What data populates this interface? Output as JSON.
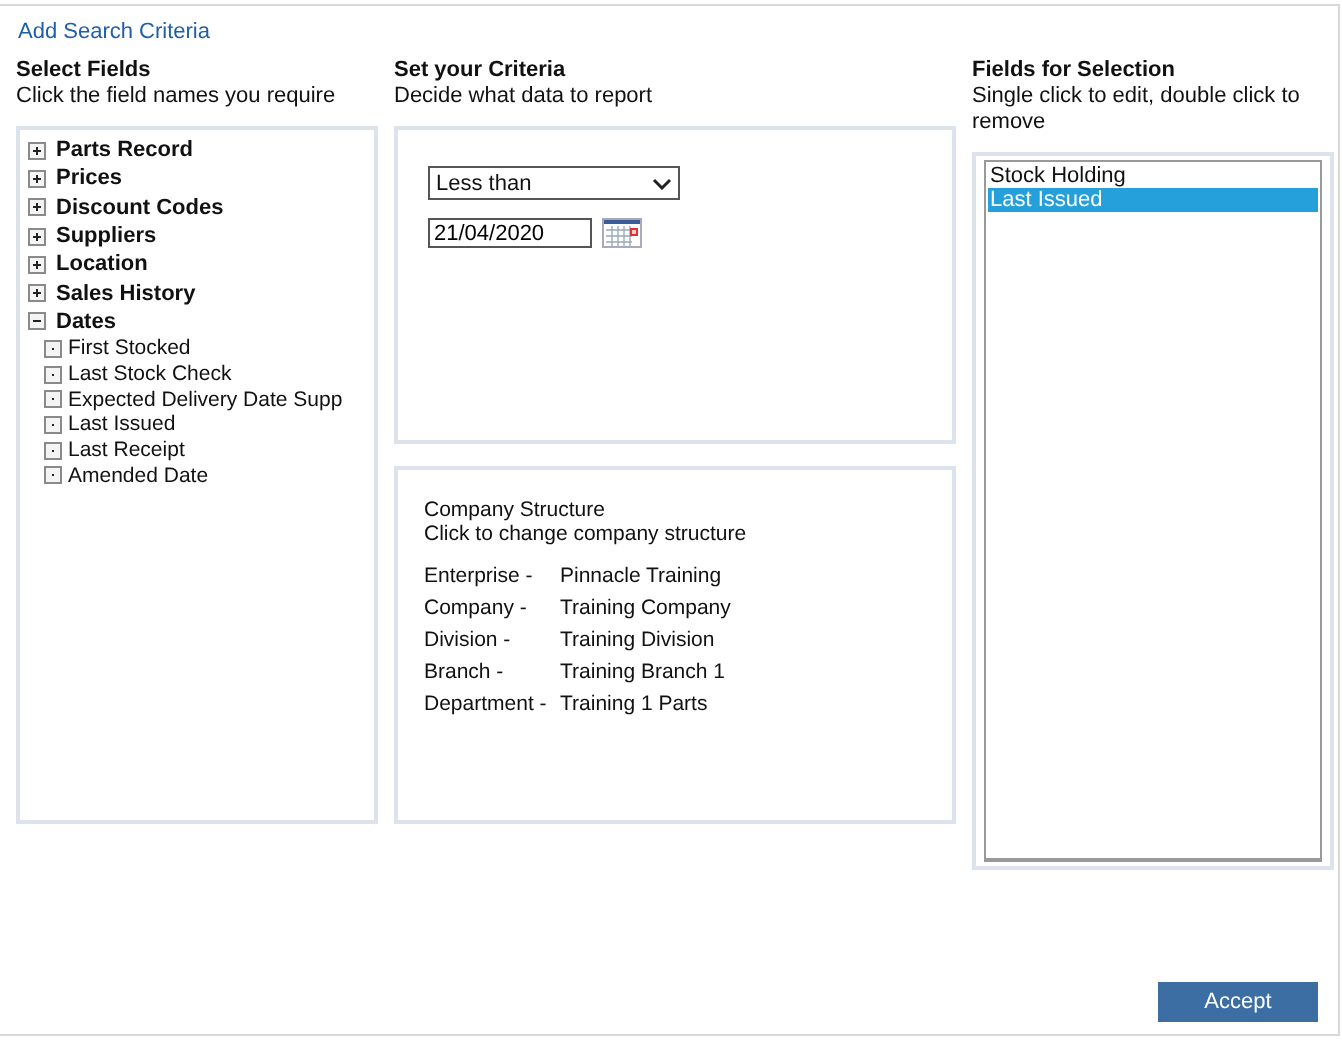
{
  "title": "Add Search Criteria",
  "select_fields": {
    "heading": "Select Fields",
    "hint": "Click the field names you require",
    "tree": [
      {
        "label": "Parts Record",
        "expanded": false
      },
      {
        "label": "Prices",
        "expanded": false
      },
      {
        "label": "Discount Codes",
        "expanded": false
      },
      {
        "label": "Suppliers",
        "expanded": false
      },
      {
        "label": "Location",
        "expanded": false
      },
      {
        "label": "Sales History",
        "expanded": false
      },
      {
        "label": "Dates",
        "expanded": true,
        "children": [
          {
            "label": "First Stocked"
          },
          {
            "label": "Last Stock Check"
          },
          {
            "label": "Expected Delivery Date Supp"
          },
          {
            "label": "Last Issued"
          },
          {
            "label": "Last Receipt"
          },
          {
            "label": "Amended Date"
          }
        ]
      }
    ]
  },
  "criteria": {
    "heading": "Set your Criteria",
    "hint": "Decide what data to report",
    "operator": "Less than",
    "date": "21/04/2020"
  },
  "company_structure": {
    "title": "Company Structure",
    "hint": "Click to change company structure",
    "rows": [
      {
        "label": "Enterprise -",
        "value": "Pinnacle Training"
      },
      {
        "label": "Company -",
        "value": "Training Company"
      },
      {
        "label": "Division -",
        "value": "Training Division"
      },
      {
        "label": "Branch -",
        "value": "Training Branch 1"
      },
      {
        "label": "Department -",
        "value": "Training 1 Parts"
      }
    ]
  },
  "fields_for_selection": {
    "heading": "Fields for Selection",
    "hint": "Single click to edit, double click to remove",
    "items": [
      {
        "label": "Stock Holding",
        "selected": false
      },
      {
        "label": "Last Issued",
        "selected": true
      }
    ]
  },
  "buttons": [
    "Accept"
  ]
}
